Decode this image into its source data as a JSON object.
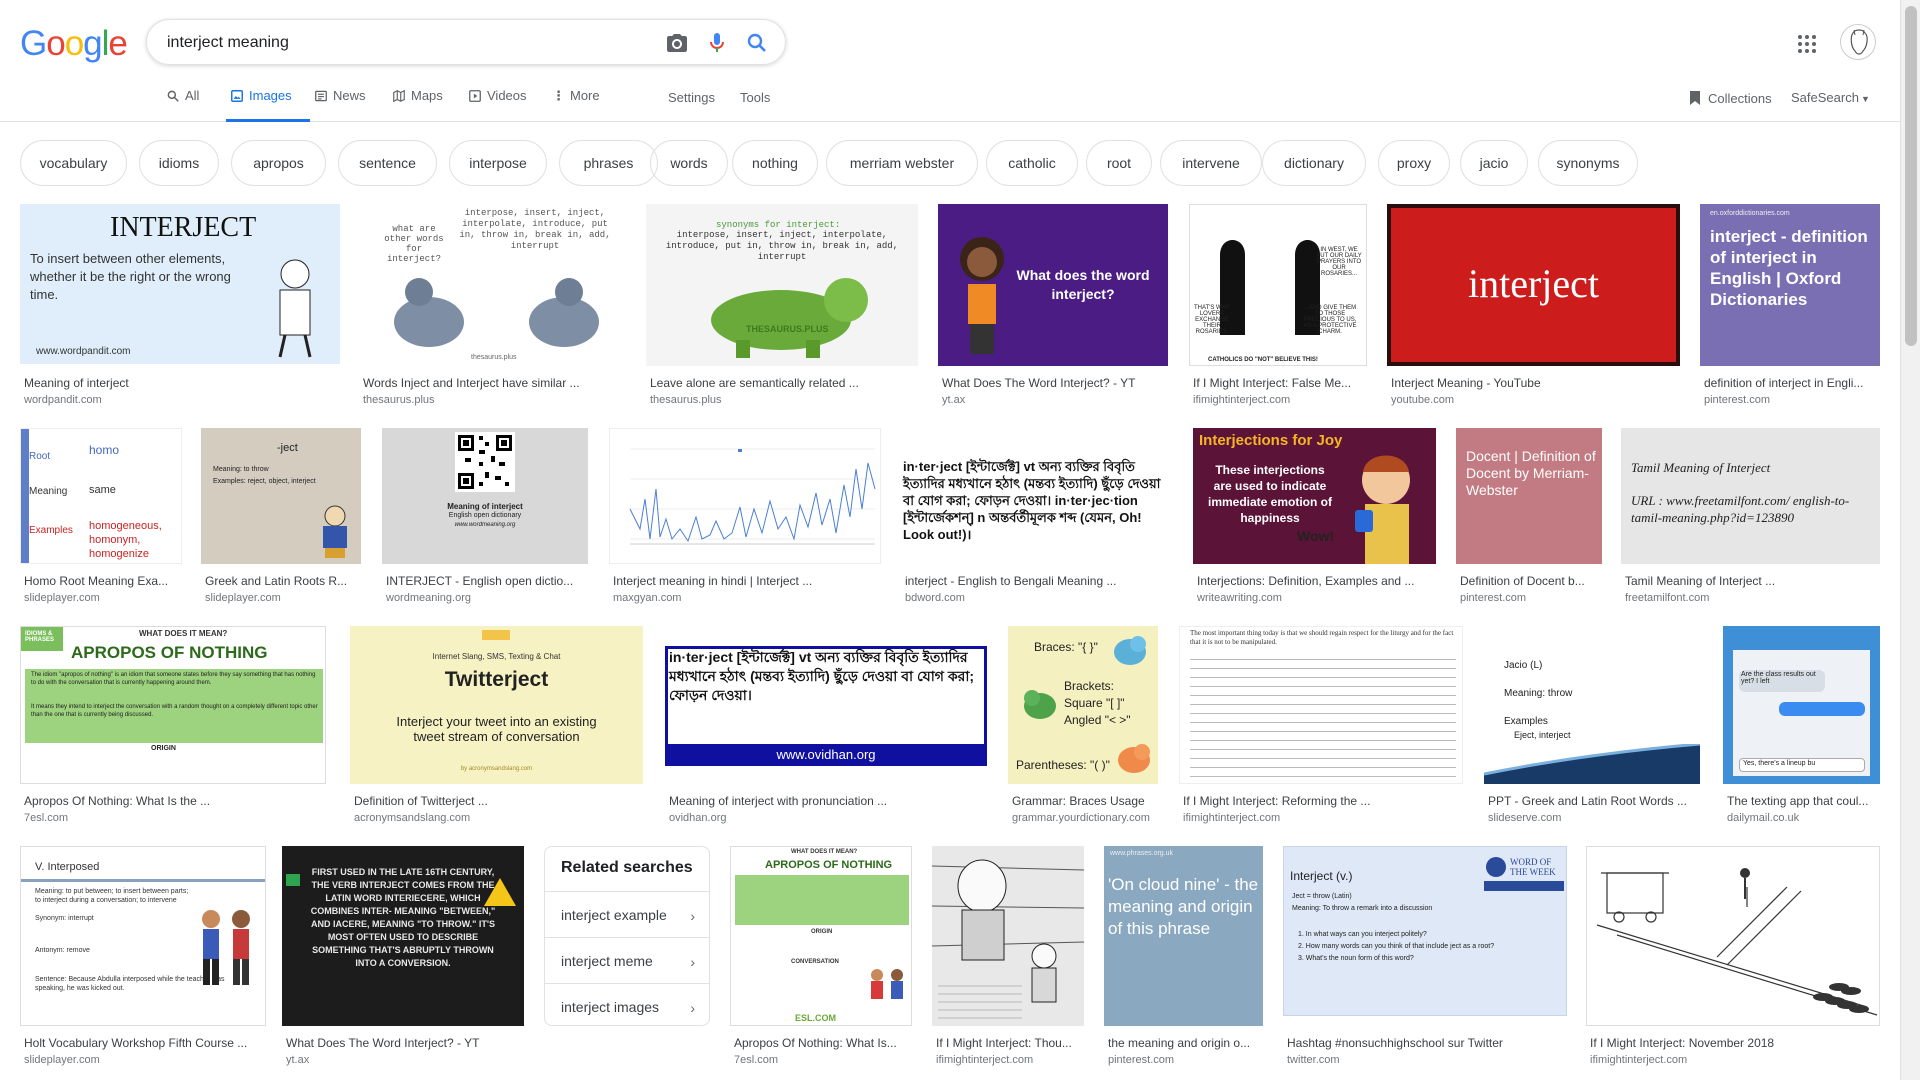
{
  "header": {
    "logo_letters": [
      "G",
      "o",
      "o",
      "g",
      "l",
      "e"
    ],
    "logo_colors": [
      "#4285F4",
      "#EA4335",
      "#FBBC05",
      "#4285F4",
      "#34A853",
      "#EA4335"
    ],
    "search_value": "interject meaning",
    "accent": "#1a73e8"
  },
  "tabs": [
    {
      "label": "All",
      "icon": "search-icon"
    },
    {
      "label": "Images",
      "icon": "image-icon",
      "active": true
    },
    {
      "label": "News",
      "icon": "news-icon"
    },
    {
      "label": "Maps",
      "icon": "map-icon"
    },
    {
      "label": "Videos",
      "icon": "video-icon"
    },
    {
      "label": "More",
      "icon": "more-vert-icon"
    }
  ],
  "tools": {
    "settings": "Settings",
    "tools": "Tools",
    "collections": "Collections",
    "safesearch": "SafeSearch"
  },
  "chips": [
    "vocabulary",
    "idioms",
    "apropos",
    "sentence",
    "interpose",
    "phrases",
    "words",
    "nothing",
    "merriam webster",
    "catholic",
    "root",
    "intervene",
    "dictionary",
    "proxy",
    "jacio",
    "synonyms"
  ],
  "results": [
    {
      "caption": "Meaning of interject",
      "source": "wordpandit.com",
      "thumb_text": [
        "INTERJECT",
        "To insert between other elements, whether it be the right or the wrong time.",
        "www.wordpandit.com"
      ]
    },
    {
      "caption": "Words Inject and Interject have similar ...",
      "source": "thesaurus.plus",
      "thumb_text": [
        "what are other words for interject?",
        "interpose, insert, inject, interpolate, introduce, put in, throw in, break in, add, interrupt",
        "thesaurus.plus"
      ]
    },
    {
      "caption": "Leave alone are semantically related ...",
      "source": "thesaurus.plus",
      "thumb_text": [
        "synonyms for interject:",
        "interpose, insert, inject, interpolate, introduce, put in, throw in, break in, add, interrupt",
        "THESAURUS.PLUS"
      ]
    },
    {
      "caption": "What Does The Word Interject? - YT",
      "source": "yt.ax",
      "thumb_text": [
        "What does the word interject?"
      ]
    },
    {
      "caption": "If I Might Interject: False Me...",
      "source": "ifimightinterject.com",
      "thumb_text": [
        "IN WEST, WE PUT OUR DAILY PRAYERS INTO OUR ROSARIES...",
        "THAT'S WHY LOVERS EXCHANGE THEIR ROSARIES.",
        "...AND GIVE THEM TO THOSE PRECIOUS TO US, AS A PROTECTIVE CHARM.",
        "CATHOLICS DO \"NOT\" BELIEVE THIS!"
      ]
    },
    {
      "caption": "Interject Meaning - YouTube",
      "source": "youtube.com",
      "thumb_text": [
        "interject"
      ]
    },
    {
      "caption": "definition of interject in Engli...",
      "source": "pinterest.com",
      "thumb_text": [
        "en.oxforddictionaries.com",
        "interject - definition of interject in English | Oxford Dictionaries"
      ]
    },
    {
      "caption": "Homo Root Meaning Exa...",
      "source": "slideplayer.com",
      "thumb_text": [
        "Root",
        "homo",
        "Meaning",
        "same",
        "Examples",
        "homogeneous, homonym, homogenize"
      ]
    },
    {
      "caption": "Greek and Latin Roots R...",
      "source": "slideplayer.com",
      "thumb_text": [
        "-ject",
        "Meaning: to throw",
        "Examples: reject, object, interject"
      ]
    },
    {
      "caption": "INTERJECT - English open dictio...",
      "source": "wordmeaning.org",
      "thumb_text": [
        "Meaning of interject",
        "English open dictionary",
        "www.wordmeaning.org"
      ]
    },
    {
      "caption": "Interject meaning in hindi | Interject ...",
      "source": "maxgyan.com",
      "thumb_text": []
    },
    {
      "caption": "interject - English to Bengali Meaning ...",
      "source": "bdword.com",
      "thumb_text": [
        "in·ter·ject [ইন্টার্জেক্ট] vt অন্য ব্যক্তির বিবৃতি ইত্যাদির মধ্যখানে হঠাৎ (মন্তব্য ইত্যাদি) ছুঁড়ে দেওয়া বা যোগ করা; ফোড়ন দেওয়া। in·ter·jec·tion [ইন্টার্জেকশন্] n অন্তর্বর্তীমূলক শব্দ (যেমন, Oh! Look out!)।"
      ]
    },
    {
      "caption": "Interjections: Definition, Examples and ...",
      "source": "writeawriting.com",
      "thumb_text": [
        "Interjections for Joy",
        "These interjections are used to indicate immediate emotion of happiness",
        "Wow!"
      ]
    },
    {
      "caption": "Definition of Docent b...",
      "source": "pinterest.com",
      "thumb_text": [
        "Docent | Definition of Docent by Merriam-Webster"
      ]
    },
    {
      "caption": "Tamil Meaning of Interject ...",
      "source": "freetamilfont.com",
      "thumb_text": [
        "Tamil Meaning of Interject",
        "URL : www.freetamilfont.com/ english-to-tamil-meaning.php?id=123890"
      ]
    },
    {
      "caption": "Apropos Of Nothing: What Is the ...",
      "source": "7esl.com",
      "thumb_text": [
        "IDIOMS & PHRASES",
        "WHAT DOES IT MEAN?",
        "APROPOS OF NOTHING",
        "The idiom \"apropos of nothing\" is an idiom that someone states before they say something that has nothing to do with the conversation that is currently happening around them.",
        "It means they intend to interject the conversation with a random thought on a completely different topic other than the one that is currently being discussed.",
        "ORIGIN"
      ]
    },
    {
      "caption": "Definition of Twitterject ...",
      "source": "acronymsandslang.com",
      "thumb_text": [
        "Internet Slang, SMS, Texting & Chat",
        "Twitterject",
        "Interject your tweet into an existing tweet stream of conversation",
        "by acronymsandslang.com"
      ]
    },
    {
      "caption": "Meaning of interject with pronunciation ...",
      "source": "ovidhan.org",
      "thumb_text": [
        "in·ter·ject [ইন্টার্জেক্ট] vt অন্য ব্যক্তির বিবৃতি ইত্যাদির মধ্যখানে হঠাৎ (মন্তব্য ইত্যাদি) ছুঁড়ে দেওয়া বা যোগ করা; ফোড়ন দেওয়া।",
        "www.ovidhan.org"
      ]
    },
    {
      "caption": "Grammar: Braces Usage",
      "source": "grammar.yourdictionary.com",
      "thumb_text": [
        "Braces: \"{ }\"",
        "Brackets: Square \"[ ]\" Angled \"< >\"",
        "Parentheses: \"( )\""
      ]
    },
    {
      "caption": "If I Might Interject: Reforming the ...",
      "source": "ifimightinterject.com",
      "thumb_text": [
        "The most important thing today is that we should regain respect for the liturgy and for the fact that it is not to be manipulated."
      ]
    },
    {
      "caption": "PPT - Greek and Latin Root Words ...",
      "source": "slideserve.com",
      "thumb_text": [
        "Jacio (L)",
        "Meaning: throw",
        "Examples",
        "Eject, interject"
      ]
    },
    {
      "caption": "The texting app that coul...",
      "source": "dailymail.co.uk",
      "thumb_text": [
        "Are the class results out yet? I left",
        "Yes, there's a lineup bu"
      ]
    },
    {
      "caption": "Holt Vocabulary Workshop Fifth Course ...",
      "source": "slideplayer.com",
      "thumb_text": [
        "V. Interposed",
        "Meaning: to put between; to insert between parts; to interject during a conversation; to intervene",
        "Synonym: interrupt",
        "Antonym: remove",
        "Sentence: Because Abdulla interposed while the teacher was speaking, he was kicked out."
      ]
    },
    {
      "caption": "What Does The Word Interject? - YT",
      "source": "yt.ax",
      "thumb_text": [
        "FIRST USED IN THE LATE 16TH CENTURY, THE VERB INTERJECT COMES FROM THE LATIN WORD INTERIECERE, WHICH COMBINES INTER- MEANING \"BETWEEN,\" AND IACERE, MEANING \"TO THROW.\" IT'S MOST OFTEN USED TO DESCRIBE SOMETHING THAT'S ABRUPTLY THROWN INTO A CONVERSION."
      ]
    },
    {
      "caption": "Apropos Of Nothing: What Is...",
      "source": "7esl.com",
      "thumb_text": [
        "WHAT DOES IT MEAN?",
        "APROPOS OF NOTHING",
        "ORIGIN",
        "CONVERSATION",
        "ESL.COM"
      ]
    },
    {
      "caption": "If I Might Interject: Thou...",
      "source": "ifimightinterject.com",
      "thumb_text": []
    },
    {
      "caption": "the meaning and origin o...",
      "source": "pinterest.com",
      "thumb_text": [
        "www.phrases.org.uk",
        "'On cloud nine' - the meaning and origin of this phrase"
      ]
    },
    {
      "caption": "Hashtag #nonsuchhighschool sur Twitter",
      "source": "twitter.com",
      "thumb_text": [
        "Interject (v.)",
        "Ject = throw (Latin)",
        "Meaning: To throw a remark into a discussion",
        "1. In what ways can you interject politely?",
        "2. How many words can you think of that include ject as a root?",
        "3. What's the noun form of this word?",
        "WORD OF THE WEEK"
      ]
    },
    {
      "caption": "If I Might Interject: November 2018",
      "source": "ifimightinterject.com",
      "thumb_text": []
    }
  ],
  "related": {
    "title": "Related searches",
    "items": [
      "interject example",
      "interject meme",
      "interject images"
    ]
  }
}
